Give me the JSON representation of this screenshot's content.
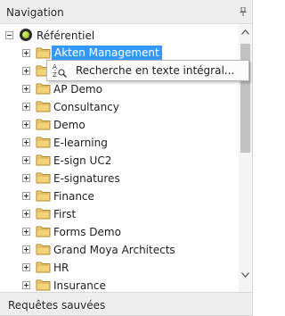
{
  "header": {
    "title": "Navigation",
    "pin_icon": "pin-icon"
  },
  "tree": {
    "root": {
      "label": "Référentiel",
      "icon": "repository-icon"
    },
    "items": [
      {
        "label": "Akten Management",
        "selected": true
      },
      {
        "label": ""
      },
      {
        "label": "AP Demo"
      },
      {
        "label": "Consultancy"
      },
      {
        "label": "Demo"
      },
      {
        "label": "E-learning"
      },
      {
        "label": "E-sign UC2"
      },
      {
        "label": "E-signatures"
      },
      {
        "label": "Finance"
      },
      {
        "label": "First"
      },
      {
        "label": "Forms Demo"
      },
      {
        "label": "Grand Moya Architects"
      },
      {
        "label": "HR"
      },
      {
        "label": "Insurance"
      }
    ]
  },
  "context_menu": {
    "items": [
      {
        "label": "Recherche en texte intégral...",
        "icon": "full-text-search-icon"
      }
    ]
  },
  "footer": {
    "title": "Requêtes sauvées"
  },
  "colors": {
    "selection": "#3399ff",
    "panel_header": "#eeeeee",
    "folder": "#f3d27a"
  }
}
